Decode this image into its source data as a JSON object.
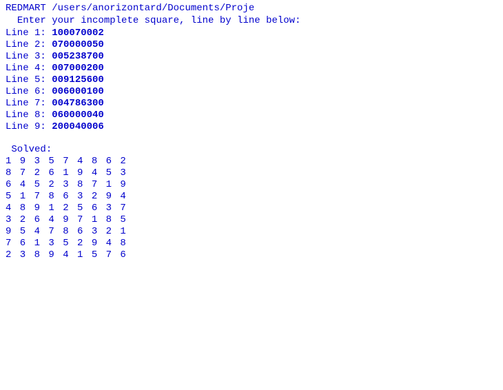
{
  "header": {
    "path_text": "REDMART /users/anorizontard/Documents/Proje"
  },
  "prompt": {
    "text": "Enter your incomplete square, line by line below:"
  },
  "input_lines": [
    {
      "label": "Line 1:",
      "value": "100070002"
    },
    {
      "label": "Line 2:",
      "value": "070000050"
    },
    {
      "label": "Line 3:",
      "value": "005238700"
    },
    {
      "label": "Line 4:",
      "value": "007000200"
    },
    {
      "label": "Line 5:",
      "value": "009125600"
    },
    {
      "label": "Line 6:",
      "value": "006000100"
    },
    {
      "label": "Line 7:",
      "value": "004786300"
    },
    {
      "label": "Line 8:",
      "value": "060000040"
    },
    {
      "label": "Line 9:",
      "value": "200040006"
    }
  ],
  "solved_label": "Solved:",
  "solution_rows": [
    "1 9 3 5 7 4 8 6 2",
    "8 7 2 6 1 9 4 5 3",
    "6 4 5 2 3 8 7 1 9",
    "5 1 7 8 6 3 2 9 4",
    "4 8 9 1 2 5 6 3 7",
    "3 2 6 4 9 7 1 8 5",
    "9 5 4 7 8 6 3 2 1",
    "7 6 1 3 5 2 9 4 8",
    "2 3 8 9 4 1 5 7 6"
  ]
}
